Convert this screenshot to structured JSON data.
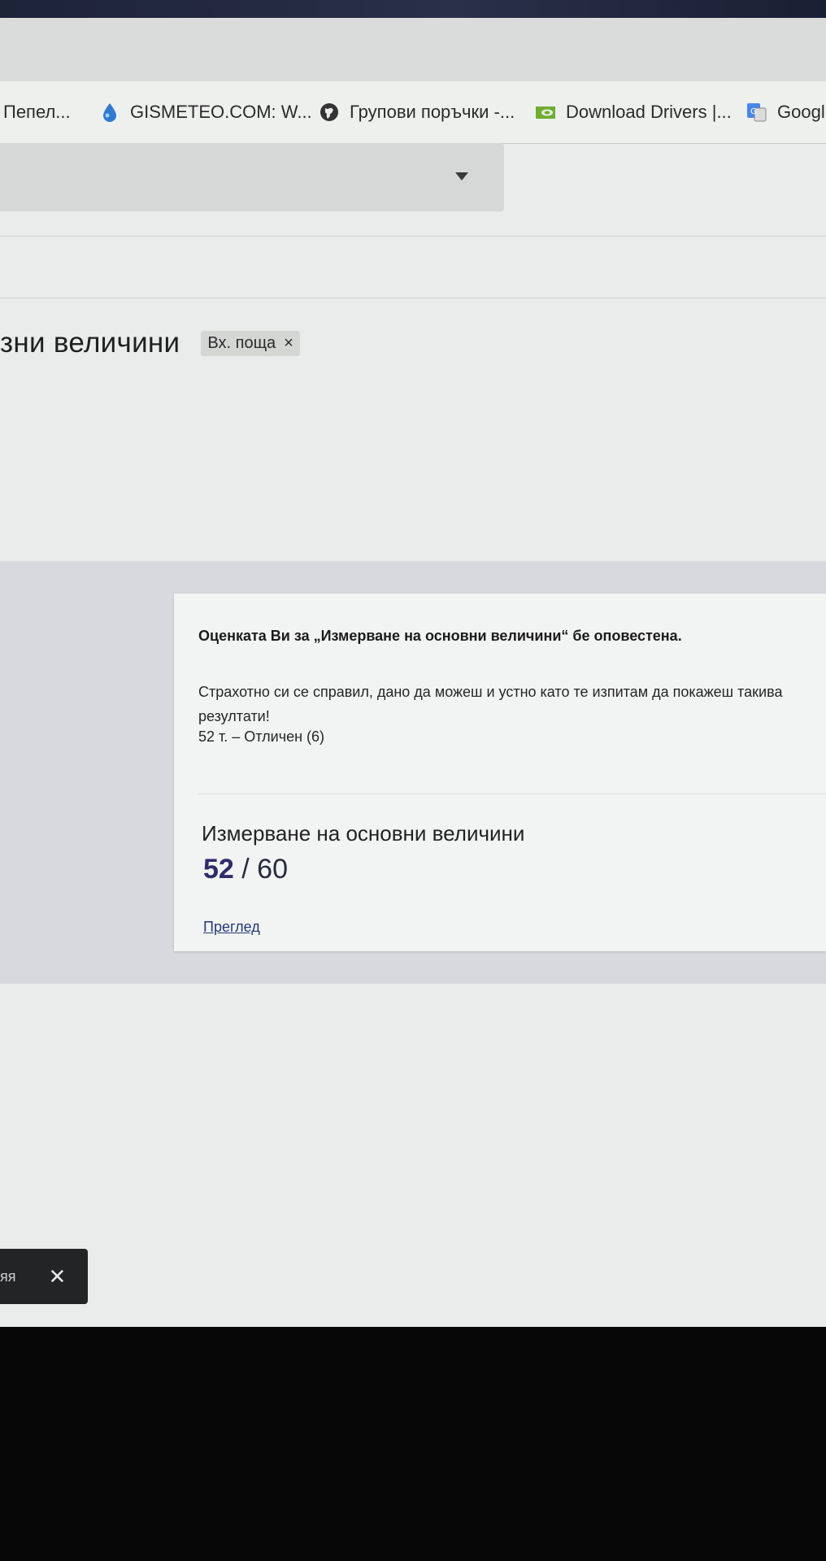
{
  "bookmarks": [
    {
      "label": "Пепел...",
      "icon": "none"
    },
    {
      "label": "GISMETEO.COM: W...",
      "icon": "drop-icon"
    },
    {
      "label": "Групови поръчки -...",
      "icon": "globe-icon"
    },
    {
      "label": "Download Drivers |...",
      "icon": "nvidia-icon"
    },
    {
      "label": "Googl",
      "icon": "google-translate-icon"
    }
  ],
  "subject": {
    "title": "зни величини",
    "chip_label": "Вх. поща",
    "chip_close": "×"
  },
  "card": {
    "heading": "Оценката Ви за „Измерване на основни величини“ бе оповестена.",
    "message": "Страхотно си се справил, дано да можеш и устно като те изпитам да покажеш такива резултати!",
    "grade_line": "52 т. – Отличен (6)",
    "quiz_name": "Измерване на основни величини",
    "score_got": "52",
    "score_sep": " / ",
    "score_total": "60",
    "review_label": "Преглед"
  },
  "toast": {
    "text": "яя",
    "close": "✕"
  }
}
